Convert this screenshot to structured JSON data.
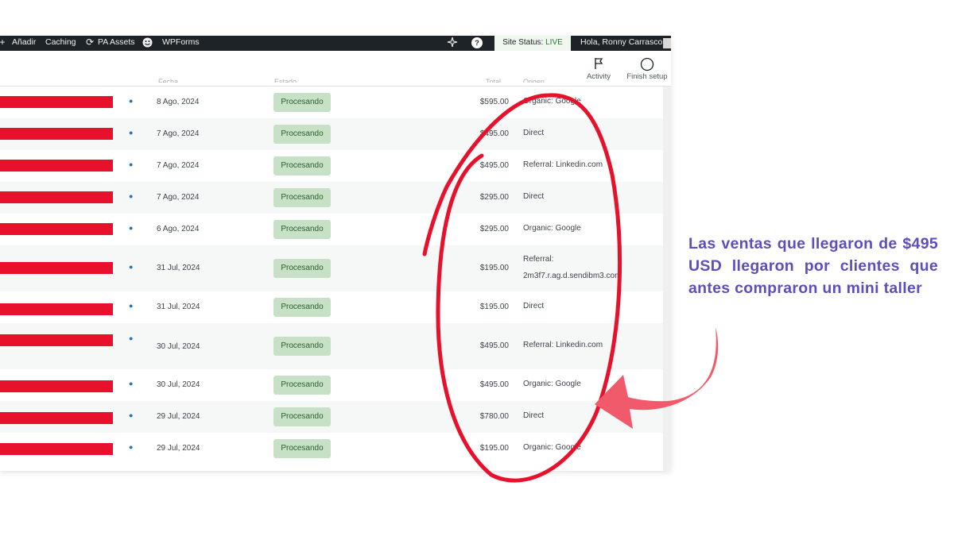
{
  "admin_bar": {
    "add_label": "Añadir",
    "caching_label": "Caching",
    "pa_assets_label": "PA Assets",
    "wpforms_label": "WPForms",
    "help_label": "?",
    "site_status_label": "Site Status:",
    "site_status_value": "LIVE",
    "greeting": "Hola, Ronny Carrasco"
  },
  "header": {
    "activity_label": "Activity",
    "finish_setup_label": "Finish setup"
  },
  "columns": {
    "date": "Fecha",
    "status": "Estado",
    "total": "Total",
    "origin": "Origen"
  },
  "orders": [
    {
      "date": "8 Ago, 2024",
      "status": "Procesando",
      "total": "$595.00",
      "origin": "Organic: Google"
    },
    {
      "date": "7 Ago, 2024",
      "status": "Procesando",
      "total": "$495.00",
      "origin": "Direct"
    },
    {
      "date": "7 Ago, 2024",
      "status": "Procesando",
      "total": "$495.00",
      "origin": "Referral: Linkedin.com"
    },
    {
      "date": "7 Ago, 2024",
      "status": "Procesando",
      "total": "$295.00",
      "origin": "Direct"
    },
    {
      "date": "6 Ago, 2024",
      "status": "Procesando",
      "total": "$295.00",
      "origin": "Organic: Google"
    },
    {
      "date": "31 Jul, 2024",
      "status": "Procesando",
      "total": "$195.00",
      "origin": "Referral:",
      "origin_line2": "2m3f7.r.ag.d.sendibm3.com"
    },
    {
      "date": "31 Jul, 2024",
      "status": "Procesando",
      "total": "$195.00",
      "origin": "Direct"
    },
    {
      "date": "30 Jul, 2024",
      "status": "Procesando",
      "total": "$495.00",
      "origin": "Referral: Linkedin.com"
    },
    {
      "date": "30 Jul, 2024",
      "status": "Procesando",
      "total": "$495.00",
      "origin": "Organic: Google"
    },
    {
      "date": "29 Jul, 2024",
      "status": "Procesando",
      "total": "$780.00",
      "origin": "Direct"
    },
    {
      "date": "29 Jul, 2024",
      "status": "Procesando",
      "total": "$195.00",
      "origin": "Organic: Google"
    }
  ],
  "annotation": {
    "text": "Las ventas que llegaron de $495 USD llegaron por clientes que antes compraron un mini taller",
    "color": "#5b4fbd",
    "highlight_color": "#e8112c"
  }
}
